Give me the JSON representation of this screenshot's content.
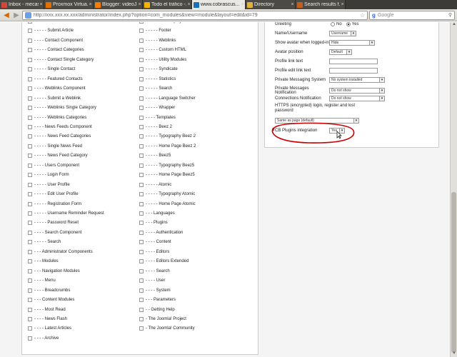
{
  "tabs": [
    {
      "label": "Inbox - mecasof...",
      "icon": "gmail-icon",
      "color": "#d44638"
    },
    {
      "label": "Proxmox Virtua...",
      "icon": "proxmox-icon",
      "color": "#e57000"
    },
    {
      "label": "Blogger: videoJ...",
      "icon": "blogger-icon",
      "color": "#f57d00"
    },
    {
      "label": "Todo el tráfico -...",
      "icon": "analytics-icon",
      "color": "#f4b400"
    },
    {
      "label": "www.cobrascus...",
      "icon": "joomla-icon",
      "color": "#1a6fb5",
      "active": true
    },
    {
      "label": "Directory",
      "icon": "directory-icon",
      "color": "#e0b040"
    },
    {
      "label": "Search results f...",
      "icon": "search-results-icon",
      "color": "#c06020"
    }
  ],
  "nav": {
    "url": "http://xxx.xxx.xx.xxx/administrator/index.php?option=com_modules&view=module&layout=edit&id=79",
    "search_placeholder": "Google"
  },
  "left_col1": [
    "- - - - - Archived Articles",
    "- - - - - Submit Article",
    "- - - - Contact Component",
    "- - - - - Contact Categories",
    "- - - - - Contact Single Category",
    "- - - - - Single Contact",
    "- - - - - Featured Contacts",
    "- - - - Weblinks Component",
    "- - - - - Submit a Weblink",
    "- - - - - Weblinks Single Category",
    "- - - - - Weblinks Categories",
    "- - - - News Feeds Component",
    "- - - - - News Feed Categories",
    "- - - - - Single News Feed",
    "- - - - - News Feed Category",
    "- - - - Users Component",
    "- - - - - Login Form",
    "- - - - - User Profile",
    "- - - - - Edit User Profile",
    "- - - - - Registration Form",
    "- - - - - Username Reminder Request",
    "- - - - - Password Reset",
    "- - - - Search Component",
    "- - - - - Search",
    "- - - Administrator Components",
    "- - - Modules",
    "- - - Navigation Modules",
    "- - - - Menu",
    "- - - - Breadcrumbs",
    "- - - Content Modules",
    "- - - - Most Read",
    "- - - - News Flash",
    "- - - - Latest Articles",
    "- - - - Archive"
  ],
  "left_col2": [
    "- - - - - Bed Display",
    "- - - - - Footer",
    "- - - - - Weblinks",
    "- - - - - Custom HTML",
    "- - - - - Utility Modules",
    "- - - - - Syndicate",
    "- - - - - Statistics",
    "- - - - - Search",
    "- - - - - Language Switcher",
    "- - - - - Wrapper",
    "- - - - Templates",
    "- - - - - Beez 2",
    "- - - - - Typography Beez 2",
    "- - - - - Home Page Beez 2",
    "- - - - - Beez5",
    "- - - - - Typography Beez5",
    "- - - - - Home Page Beez5",
    "- - - - - Atomic",
    "- - - - - Typography Atomic",
    "- - - - - Home Page Atomic",
    "- - - Languages",
    "- - - Plugins",
    "- - - - Authentication",
    "- - - - Content",
    "- - - - Editors",
    "- - - - Editors Extended",
    "- - - - Search",
    "- - - - User",
    "- - - - System",
    "- - - Parameters",
    "- - Getting Help",
    "- The Joomla! Project",
    "- The Joomla! Community"
  ],
  "params": {
    "greeting": {
      "label": "Greeting",
      "no": "No",
      "yes": "Yes"
    },
    "name_username": {
      "label": "Name/Username",
      "value": "Username"
    },
    "show_avatar": {
      "label": "Show avatar when logged-in",
      "value": "Hide"
    },
    "avatar_position": {
      "label": "Avatar position",
      "value": "Default"
    },
    "profile_link_text": {
      "label": "Profile link text",
      "value": ""
    },
    "profile_edit_link_text": {
      "label": "Profile edit link text",
      "value": ""
    },
    "private_messaging": {
      "label": "Private Messaging System",
      "value": "No system installed"
    },
    "private_messages_notification": {
      "label": "Private Messages Notification",
      "value": "Do not show"
    },
    "connections_notification": {
      "label": "Connections Notification",
      "value": "Do not show"
    },
    "https_login": {
      "label": "HTTPS (encrypted) login, register and lost password",
      "value": "Same as page (default)"
    },
    "cb_plugins": {
      "label": "CB Plugins integration",
      "value": "Yes"
    }
  },
  "colors": {
    "highlight": "#cc0000",
    "accent": "#d06a0a"
  }
}
